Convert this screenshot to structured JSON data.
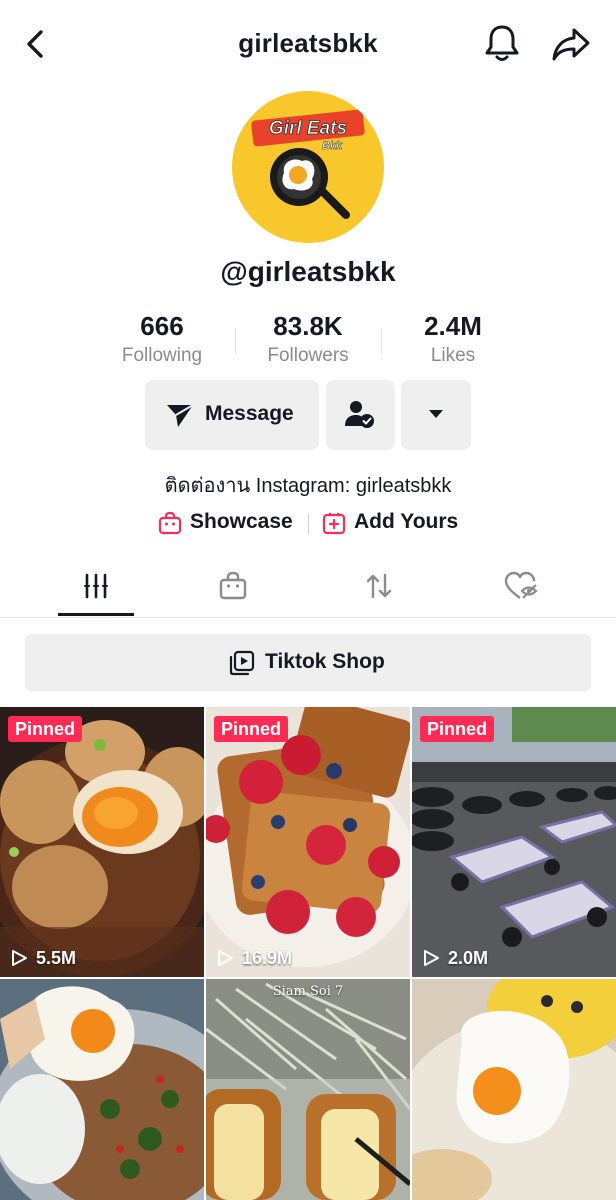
{
  "header": {
    "title": "girleatsbkk",
    "back_icon": "chevron-left-icon",
    "bell_icon": "bell-icon",
    "share_icon": "share-arrow-icon"
  },
  "profile": {
    "avatar_text_main": "Girl Eats",
    "avatar_text_sub": "Bkk",
    "handle": "@girleatsbkk",
    "bio": "ติดต่องาน Instagram: girleatsbkk"
  },
  "stats": [
    {
      "value": "666",
      "label": "Following"
    },
    {
      "value": "83.8K",
      "label": "Followers"
    },
    {
      "value": "2.4M",
      "label": "Likes"
    }
  ],
  "actions": {
    "message_label": "Message"
  },
  "links": {
    "showcase_label": "Showcase",
    "add_yours_label": "Add Yours"
  },
  "tabs": [
    {
      "name": "videos",
      "icon": "grid-icon",
      "active": true
    },
    {
      "name": "shop",
      "icon": "shopping-bag-icon",
      "active": false
    },
    {
      "name": "reposts",
      "icon": "repost-icon",
      "active": false
    },
    {
      "name": "liked",
      "icon": "hidden-heart-icon",
      "active": false
    }
  ],
  "shop_bar": {
    "label": "Tiktok Shop"
  },
  "videos": [
    {
      "pinned": "Pinned",
      "views": "5.5M"
    },
    {
      "pinned": "Pinned",
      "views": "16.9M"
    },
    {
      "pinned": "Pinned",
      "views": "2.0M"
    },
    {
      "pinned": "",
      "views": ""
    },
    {
      "pinned": "",
      "views": "",
      "caption": "Siam Soi 7"
    },
    {
      "pinned": "",
      "views": ""
    }
  ],
  "colors": {
    "accent": "#fe2c55",
    "text": "#161823",
    "muted": "#8a8b91",
    "button_bg": "#efeff0",
    "avatar_bg": "#f7c72b"
  }
}
